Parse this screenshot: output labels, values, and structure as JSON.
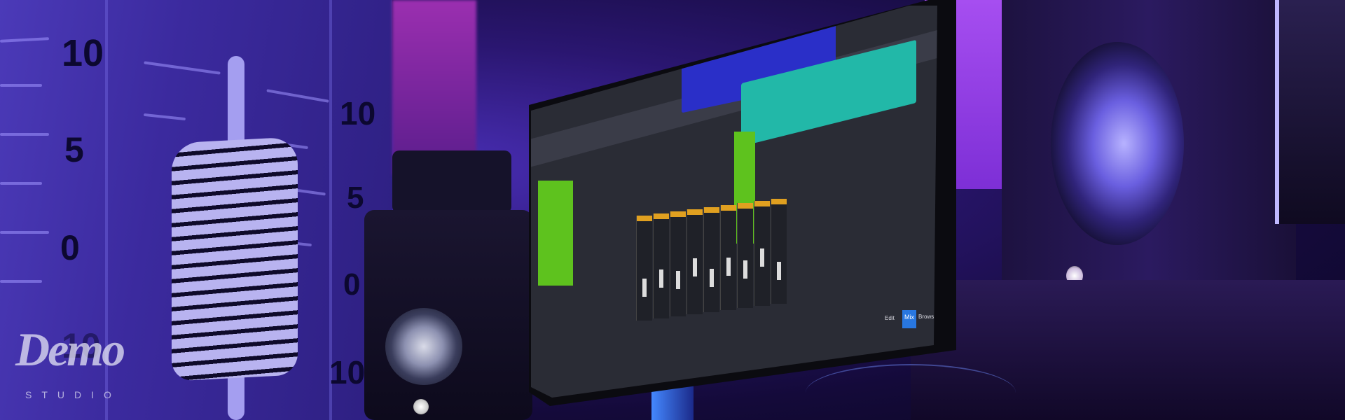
{
  "scene": {
    "description_type": "photo",
    "accent_colors": [
      "#4b3ab8",
      "#a64ef0",
      "#5ec21e",
      "#2877e0",
      "#0b0b10"
    ]
  },
  "wall_scale": {
    "left_column": [
      "10",
      "5",
      "0",
      "10"
    ],
    "right_column": [
      "10",
      "5",
      "0",
      "10"
    ]
  },
  "logo": {
    "word": "Demo",
    "subtitle": "STUDIO"
  },
  "daw": {
    "buttons": [
      "Edit",
      "Mix",
      "Browse"
    ],
    "channel_count": 9
  }
}
